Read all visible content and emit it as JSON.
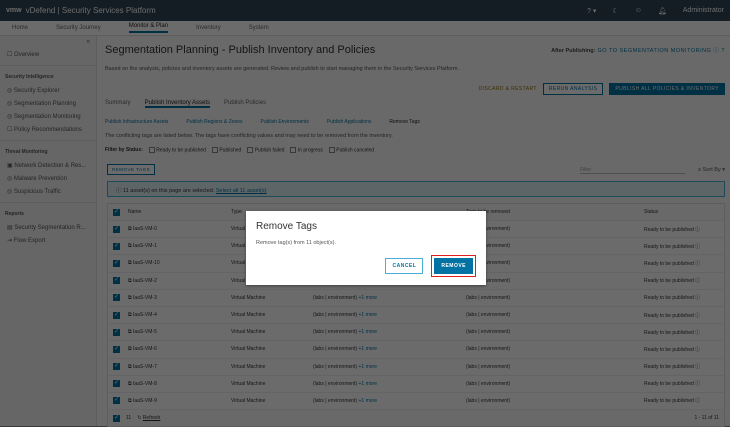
{
  "header": {
    "logo": "vmw",
    "title": "vDefend | Security Services Platform",
    "user": "Administrator"
  },
  "nav": [
    "Home",
    "Security Journey",
    "Monitor & Plan",
    "Inventory",
    "System"
  ],
  "sidebar": {
    "overview": "Overview",
    "sections": [
      {
        "title": "Security Intelligence",
        "items": [
          "Security Explorer",
          "Segmentation Planning",
          "Segmentation Monitoring",
          "Policy Recommendations"
        ]
      },
      {
        "title": "Threat Monitoring",
        "items": [
          "Network Detection & Res...",
          "Malware Prevention",
          "Suspicious Traffic"
        ]
      },
      {
        "title": "Reports",
        "items": [
          "Security Segmentation R...",
          "Flow Export"
        ]
      }
    ]
  },
  "page": {
    "title": "Segmentation Planning - Publish Inventory and Policies",
    "after_label": "After Publishing:",
    "after_link": "GO TO SEGMENTATION MONITORING",
    "description": "Based on the analysis, policies and inventory assets are generated. Review and publish to start managing them in the Security Services Platform.",
    "discard": "DISCARD & RESTART",
    "rerun": "RERUN ANALYSIS",
    "publish_all": "PUBLISH ALL POLICIES & INVENTORY",
    "tabs": [
      "Summary",
      "Publish Inventory Assets",
      "Publish Policies"
    ],
    "subtabs": [
      "Publish Infrastructure Assets",
      "Publish Regions & Zones",
      "Publish Environments",
      "Publish Applications",
      "Remove Tags"
    ],
    "conflict_text": "The conflicting tags are listed below. The tags have conflicting values and may need to be removed from the inventory.",
    "filter_label": "Filter by Status:",
    "statuses": [
      "Ready to be published",
      "Published",
      "Publish failed",
      "In progress",
      "Publish canceled"
    ],
    "remove_tags": "REMOVE TAGS",
    "filter_placeholder": "Filter",
    "sort_by": "Sort By",
    "banner_text": "11 asset(s) on this page are selected.",
    "banner_link": "Select all 11 asset(s)"
  },
  "table": {
    "columns": [
      "Name",
      "Type",
      "",
      "Tags to be removed",
      "Status"
    ],
    "rows": [
      {
        "name": "IaaS-VM-0",
        "type": "Virtual Machine",
        "tags": "(labs | environment)",
        "more": "+1 more",
        "remove": "(labs | environment)",
        "status": "Ready to be published"
      },
      {
        "name": "IaaS-VM-1",
        "type": "Virtual Machine",
        "tags": "(labs | environment)",
        "more": "+1 more",
        "remove": "(labs | environment)",
        "status": "Ready to be published"
      },
      {
        "name": "IaaS-VM-10",
        "type": "Virtual Machine",
        "tags": "(labs | environment)",
        "more": "+1 more",
        "remove": "(labs | environment)",
        "status": "Ready to be published"
      },
      {
        "name": "IaaS-VM-2",
        "type": "Virtual Machine",
        "tags": "(labs | environment)",
        "more": "+1 more",
        "remove": "(labs | environment)",
        "status": "Ready to be published"
      },
      {
        "name": "IaaS-VM-3",
        "type": "Virtual Machine",
        "tags": "(labs | environment)",
        "more": "+1 more",
        "remove": "(labs | environment)",
        "status": "Ready to be published"
      },
      {
        "name": "IaaS-VM-4",
        "type": "Virtual Machine",
        "tags": "(labs | environment)",
        "more": "+1 more",
        "remove": "(labs | environment)",
        "status": "Ready to be published"
      },
      {
        "name": "IaaS-VM-5",
        "type": "Virtual Machine",
        "tags": "(labs | environment)",
        "more": "+1 more",
        "remove": "(labs | environment)",
        "status": "Ready to be published"
      },
      {
        "name": "IaaS-VM-6",
        "type": "Virtual Machine",
        "tags": "(labs | environment)",
        "more": "+1 more",
        "remove": "(labs | environment)",
        "status": "Ready to be published"
      },
      {
        "name": "IaaS-VM-7",
        "type": "Virtual Machine",
        "tags": "(labs | environment)",
        "more": "+1 more",
        "remove": "(labs | environment)",
        "status": "Ready to be published"
      },
      {
        "name": "IaaS-VM-8",
        "type": "Virtual Machine",
        "tags": "(labs | environment)",
        "more": "+1 more",
        "remove": "(labs | environment)",
        "status": "Ready to be published"
      },
      {
        "name": "IaaS-VM-9",
        "type": "Virtual Machine",
        "tags": "(labs | environment)",
        "more": "+1 more",
        "remove": "(labs | environment)",
        "status": "Ready to be published"
      }
    ],
    "footer_count": "11",
    "refresh": "Refresh",
    "pagination": "1 - 11 of 11"
  },
  "modal": {
    "title": "Remove Tags",
    "message": "Remove tag(s) from 11 object(s).",
    "cancel": "CANCEL",
    "remove": "REMOVE"
  },
  "colors": {
    "accent": "#0072a3",
    "highlight": "#e02020",
    "header": "#2f4656"
  }
}
